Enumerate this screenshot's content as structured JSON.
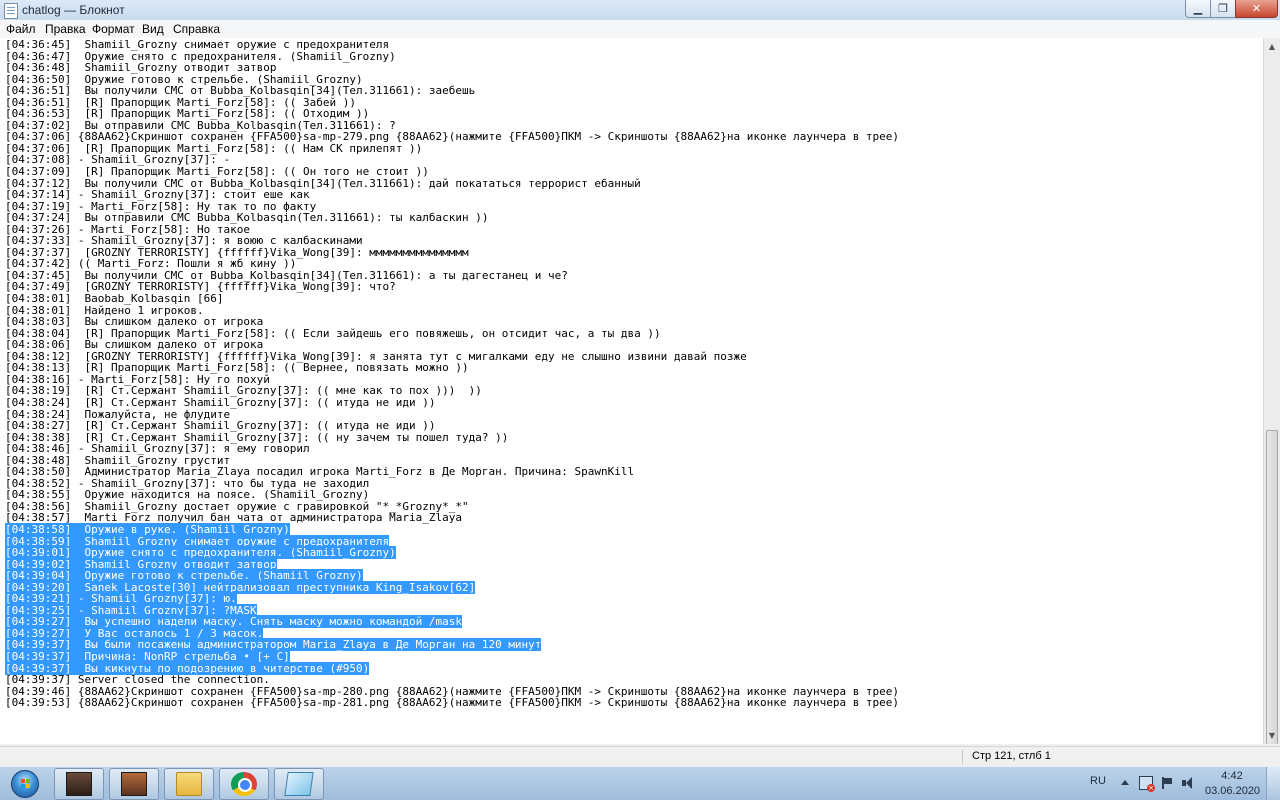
{
  "window": {
    "title": "chatlog — Блокнот",
    "minimize_glyph": "▁",
    "maximize_glyph": "❐",
    "close_glyph": "✕"
  },
  "menu": [
    "Файл",
    "Правка",
    "Формат",
    "Вид",
    "Справка"
  ],
  "log_lines": [
    {
      "text": "[04:36:45]  Shamiil_Grozny снимает оружие с предохранителя",
      "selected": false
    },
    {
      "text": "[04:36:47]  Оружие снято с предохранителя. (Shamiil_Grozny)",
      "selected": false
    },
    {
      "text": "[04:36:48]  Shamiil_Grozny отводит затвор",
      "selected": false
    },
    {
      "text": "[04:36:50]  Оружие готово к стрельбе. (Shamiil_Grozny)",
      "selected": false
    },
    {
      "text": "[04:36:51]  Вы получили СМС от Bubba_Kolbasqin[34](Тел.311661): заебешь",
      "selected": false
    },
    {
      "text": "[04:36:51]  [R] Прапорщик Marti_Forz[58]: (( Забей ))",
      "selected": false
    },
    {
      "text": "[04:36:53]  [R] Прапорщик Marti_Forz[58]: (( Отходим ))",
      "selected": false
    },
    {
      "text": "[04:37:02]  Вы отправили СМС Bubba_Kolbasqin(Тел.311661): ?",
      "selected": false
    },
    {
      "text": "[04:37:06] {88AA62}Скриншот сохранен {FFA500}sa-mp-279.png {88AA62}(нажмите {FFA500}ПКМ -> Скриншоты {88AA62}на иконке лаунчера в трее)",
      "selected": false
    },
    {
      "text": "[04:37:06]  [R] Прапорщик Marti_Forz[58]: (( Нам СК прилепят ))",
      "selected": false
    },
    {
      "text": "[04:37:08] - Shamiil_Grozny[37]: -",
      "selected": false
    },
    {
      "text": "[04:37:09]  [R] Прапорщик Marti_Forz[58]: (( Он того не стоит ))",
      "selected": false
    },
    {
      "text": "[04:37:12]  Вы получили СМС от Bubba_Kolbasqin[34](Тел.311661): дай покататься террорист ебанный",
      "selected": false
    },
    {
      "text": "[04:37:14] - Shamiil_Grozny[37]: стоит еше как",
      "selected": false
    },
    {
      "text": "[04:37:19] - Marti_Forz[58]: Ну так то по факту",
      "selected": false
    },
    {
      "text": "[04:37:24]  Вы отправили СМС Bubba_Kolbasqin(Тел.311661): ты калбаскин ))",
      "selected": false
    },
    {
      "text": "[04:37:26] - Marti_Forz[58]: Но такое",
      "selected": false
    },
    {
      "text": "[04:37:33] - Shamiil_Grozny[37]: я воюю с калбаскинами",
      "selected": false
    },
    {
      "text": "[04:37:37]  [GROZNY TERRORISTY] {ffffff}Vika_Wong[39]: ммммммммммммммм",
      "selected": false
    },
    {
      "text": "[04:37:42] (( Marti_Forz: Пошли я жб кину ))",
      "selected": false
    },
    {
      "text": "[04:37:45]  Вы получили СМС от Bubba_Kolbasqin[34](Тел.311661): а ты дагестанец и че?",
      "selected": false
    },
    {
      "text": "[04:37:49]  [GROZNY TERRORISTY] {ffffff}Vika_Wong[39]: что?",
      "selected": false
    },
    {
      "text": "[04:38:01]  Baobab_Kolbasqin [66]",
      "selected": false
    },
    {
      "text": "[04:38:01]  Найдено 1 игроков.",
      "selected": false
    },
    {
      "text": "[04:38:03]  Вы слишком далеко от игрока",
      "selected": false
    },
    {
      "text": "[04:38:04]  [R] Прапорщик Marti_Forz[58]: (( Если зайдешь его повяжешь, он отсидит час, а ты два ))",
      "selected": false
    },
    {
      "text": "[04:38:06]  Вы слишком далеко от игрока",
      "selected": false
    },
    {
      "text": "[04:38:12]  [GROZNY TERRORISTY] {ffffff}Vika_Wong[39]: я занята тут с мигалками еду не слышно извини давай позже",
      "selected": false
    },
    {
      "text": "[04:38:13]  [R] Прапорщик Marti_Forz[58]: (( Вернее, повязать можно ))",
      "selected": false
    },
    {
      "text": "[04:38:16] - Marti_Forz[58]: Ну го похуй",
      "selected": false
    },
    {
      "text": "[04:38:19]  [R] Ст.Сержант Shamiil_Grozny[37]: (( мне как то пох )))  ))",
      "selected": false
    },
    {
      "text": "[04:38:24]  [R] Ст.Сержант Shamiil_Grozny[37]: (( итуда не иди ))",
      "selected": false
    },
    {
      "text": "[04:38:24]  Пожалуйста, не флудите",
      "selected": false
    },
    {
      "text": "[04:38:27]  [R] Ст.Сержант Shamiil_Grozny[37]: (( итуда не иди ))",
      "selected": false
    },
    {
      "text": "[04:38:38]  [R] Ст.Сержант Shamiil_Grozny[37]: (( ну зачем ты пошел туда? ))",
      "selected": false
    },
    {
      "text": "[04:38:46] - Shamiil_Grozny[37]: я ему говорил",
      "selected": false
    },
    {
      "text": "[04:38:48]  Shamiil_Grozny грустит",
      "selected": false
    },
    {
      "text": "[04:38:50]  Администратор Maria_Zlaya посадил игрока Marti_Forz в Де Морган. Причина: SpawnKill",
      "selected": false
    },
    {
      "text": "[04:38:52] - Shamiil_Grozny[37]: что бы туда не заходил",
      "selected": false
    },
    {
      "text": "[04:38:55]  Оружие находится на поясе. (Shamiil_Grozny)",
      "selected": false
    },
    {
      "text": "[04:38:56]  Shamiil_Grozny достает оружие с гравировкой \"*_*Grozny*_*\"",
      "selected": false
    },
    {
      "text": "[04:38:57]  Marti_Forz получил бан чата от администратора Maria_Zlaya",
      "selected": false
    },
    {
      "text": "[04:38:58]  Оружие в руке. (Shamiil_Grozny)",
      "selected": true
    },
    {
      "text": "[04:38:59]  Shamiil_Grozny снимает оружие с предохранителя",
      "selected": true
    },
    {
      "text": "[04:39:01]  Оружие снято с предохранителя. (Shamiil_Grozny)",
      "selected": true
    },
    {
      "text": "[04:39:02]  Shamiil_Grozny отводит затвор",
      "selected": true
    },
    {
      "text": "[04:39:04]  Оружие готово к стрельбе. (Shamiil_Grozny)",
      "selected": true
    },
    {
      "text": "[04:39:20]  Sanek_Lacoste[30] нейтрализовал преступника King_Isakov[62]",
      "selected": true
    },
    {
      "text": "[04:39:21] - Shamiil_Grozny[37]: ю.",
      "selected": true
    },
    {
      "text": "[04:39:25] - Shamiil_Grozny[37]: ?MASK",
      "selected": true
    },
    {
      "text": "[04:39:27]  Вы успешно надели маску. Снять маску можно командой /mask",
      "selected": true
    },
    {
      "text": "[04:39:27]  У Вас осталось 1 / 3 масок.",
      "selected": true
    },
    {
      "text": "[04:39:37]  Вы были посажены администратором Maria_Zlaya в Де Морган на 120 минут",
      "selected": true
    },
    {
      "text": "[04:39:37]  Причина: NonRP стрельба • [+ C]",
      "selected": true
    },
    {
      "text": "[04:39:37]  Вы кикнуты по подозрению в читерстве (#950)",
      "selected": true
    },
    {
      "text": "[04:39:37] Server closed the connection.",
      "selected": false
    },
    {
      "text": "[04:39:46] {88AA62}Скриншот сохранен {FFA500}sa-mp-280.png {88AA62}(нажмите {FFA500}ПКМ -> Скриншоты {88AA62}на иконке лаунчера в трее)",
      "selected": false
    },
    {
      "text": "[04:39:53] {88AA62}Скриншот сохранен {FFA500}sa-mp-281.png {88AA62}(нажмите {FFA500}ПКМ -> Скриншоты {88AA62}на иконке лаунчера в трее)",
      "selected": false
    }
  ],
  "statusbar": {
    "cursor_position": "Стр 121, стлб 1"
  },
  "taskbar": {
    "items": [
      "avatar-1",
      "avatar-2",
      "file-explorer",
      "chrome",
      "notepad"
    ],
    "tray_language": "RU",
    "clock_time": "4:42",
    "clock_date": "03.06.2020"
  },
  "colors": {
    "selection": "#3399ff",
    "selection_text": "#ffffff"
  }
}
